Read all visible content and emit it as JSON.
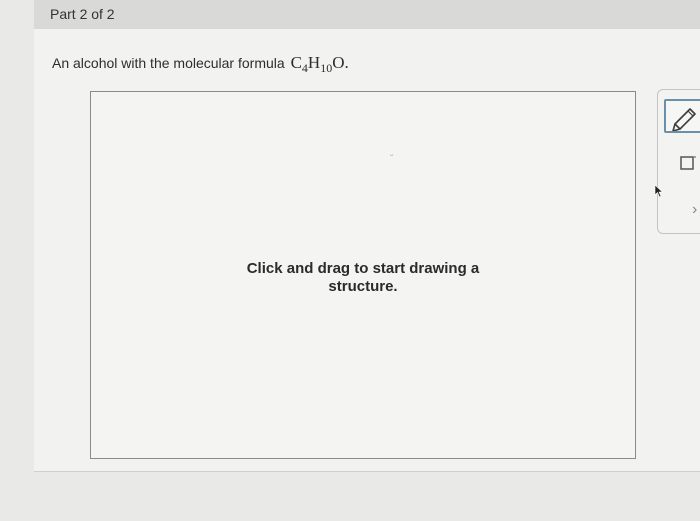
{
  "header": {
    "part_label": "Part 2 of 2"
  },
  "question": {
    "text": "An alcohol with the molecular formula",
    "formula": {
      "c": "C",
      "c_sub": "4",
      "h": "H",
      "h_sub": "10",
      "o": "O",
      "end": "."
    }
  },
  "drawing_area": {
    "instruction_line1": "Click and drag to start drawing a",
    "instruction_line2": "structure."
  },
  "toolbar": {
    "tools": [
      {
        "icon": "pencil-icon",
        "selected": true
      },
      {
        "icon": "eraser-icon",
        "selected": false
      },
      {
        "icon": "chevron-right-icon",
        "selected": false
      }
    ],
    "expand_glyph": "›"
  },
  "colors": {
    "background": "#e9e9e8",
    "header": "#d9d9d7",
    "canvas_border": "#8a8a8a",
    "tool_selected_border": "#6a8fa8"
  }
}
